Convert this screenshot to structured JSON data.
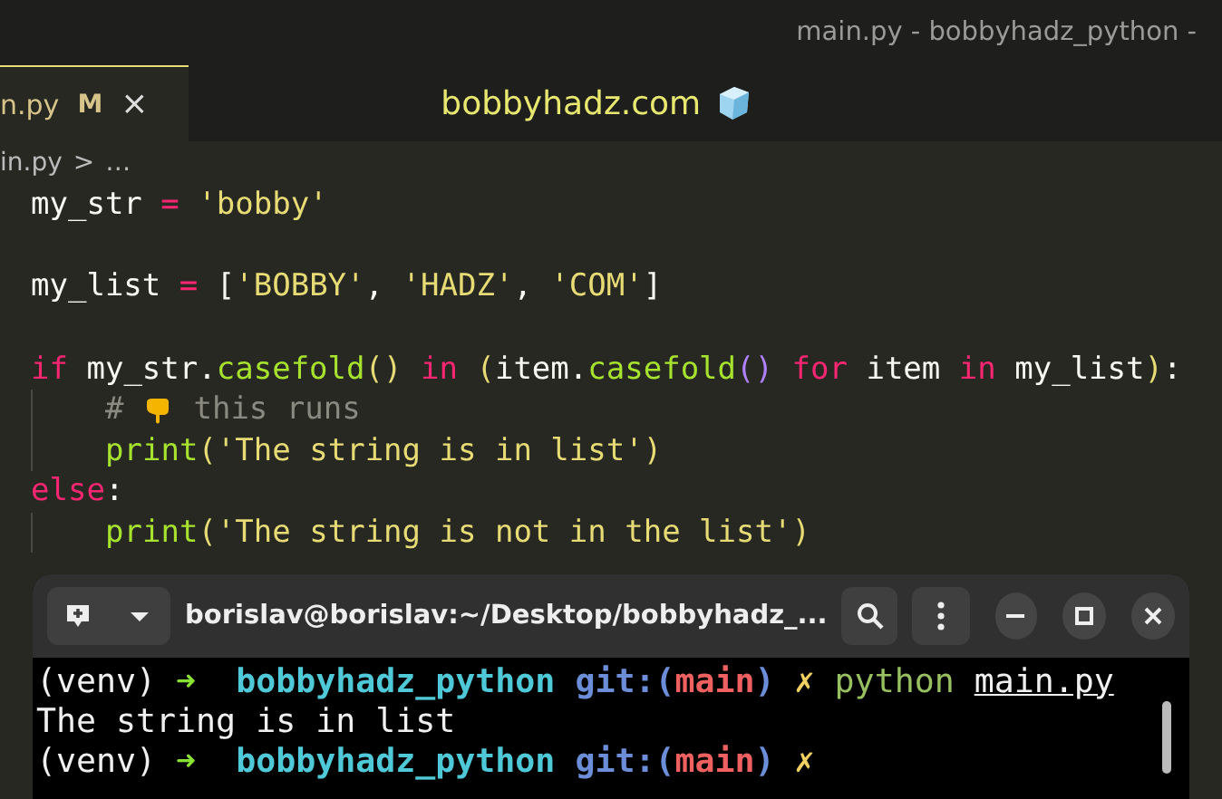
{
  "window": {
    "title": "main.py - bobbyhadz_python -"
  },
  "tabs": [
    {
      "label": "n.py",
      "badge": "M",
      "close": "×",
      "selected": true
    }
  ],
  "banner": {
    "text": "bobbyhadz.com"
  },
  "breadcrumb": {
    "file": "in.py",
    "separator": ">",
    "more": "…"
  },
  "code": [
    {
      "tokens": [
        {
          "kind": "var",
          "text": "my_str"
        },
        {
          "kind": "op",
          "text": " = "
        },
        {
          "kind": "str",
          "text": "'bobby'"
        }
      ],
      "blank_after": true
    },
    {
      "tokens": [
        {
          "kind": "var",
          "text": "my_list"
        },
        {
          "kind": "op",
          "text": " = "
        },
        {
          "kind": "plain",
          "text": "["
        },
        {
          "kind": "str",
          "text": "'BOBBY'"
        },
        {
          "kind": "plain",
          "text": ", "
        },
        {
          "kind": "str",
          "text": "'HADZ'"
        },
        {
          "kind": "plain",
          "text": ", "
        },
        {
          "kind": "str",
          "text": "'COM'"
        },
        {
          "kind": "plain",
          "text": "]"
        }
      ],
      "blank_after": true
    },
    {
      "tokens": [
        {
          "kind": "kw",
          "text": "if"
        },
        {
          "kind": "plain",
          "text": " my_str."
        },
        {
          "kind": "fn",
          "text": "casefold"
        },
        {
          "kind": "paren",
          "text": "()"
        },
        {
          "kind": "kw",
          "text": " in "
        },
        {
          "kind": "paren",
          "text": "("
        },
        {
          "kind": "plain",
          "text": "item."
        },
        {
          "kind": "fn",
          "text": "casefold"
        },
        {
          "kind": "paren2",
          "text": "()"
        },
        {
          "kind": "kw",
          "text": " for "
        },
        {
          "kind": "plain",
          "text": "item"
        },
        {
          "kind": "kw",
          "text": " in "
        },
        {
          "kind": "plain",
          "text": "my_list"
        },
        {
          "kind": "paren",
          "text": ")"
        },
        {
          "kind": "plain",
          "text": ":"
        }
      ],
      "children": [
        {
          "tokens": [
            {
              "kind": "cmt",
              "text": "# "
            },
            {
              "kind": "icon"
            },
            {
              "kind": "cmt",
              "text": " this runs"
            }
          ]
        },
        {
          "tokens": [
            {
              "kind": "fn",
              "text": "print"
            },
            {
              "kind": "paren",
              "text": "("
            },
            {
              "kind": "str",
              "text": "'The string is in list'"
            },
            {
              "kind": "paren",
              "text": ")"
            }
          ]
        }
      ]
    },
    {
      "tokens": [
        {
          "kind": "kw",
          "text": "else"
        },
        {
          "kind": "plain",
          "text": ":"
        }
      ],
      "children": [
        {
          "tokens": [
            {
              "kind": "fn",
              "text": "print"
            },
            {
              "kind": "paren",
              "text": "("
            },
            {
              "kind": "str",
              "text": "'The string is not in the list'"
            },
            {
              "kind": "paren",
              "text": ")"
            }
          ]
        }
      ]
    }
  ],
  "terminal": {
    "title": "borislav@borislav:~/Desktop/bobbyhadz_...",
    "lines": [
      {
        "tokens": [
          {
            "kind": "plain",
            "text": "(venv) "
          },
          {
            "kind": "arrow",
            "text": "➜"
          },
          {
            "kind": "dir",
            "text": "  bobbyhadz_python"
          },
          {
            "kind": "git",
            "text": " git:("
          },
          {
            "kind": "branch",
            "text": "main"
          },
          {
            "kind": "git",
            "text": ")"
          },
          {
            "kind": "dirty",
            "text": " ✗"
          },
          {
            "kind": "cmd",
            "text": " python"
          },
          {
            "kind": "file",
            "text": "main.py"
          }
        ]
      },
      {
        "tokens": [
          {
            "kind": "plain",
            "text": "The string is in list"
          }
        ]
      },
      {
        "tokens": [
          {
            "kind": "plain",
            "text": "(venv) "
          },
          {
            "kind": "arrow",
            "text": "➜"
          },
          {
            "kind": "dir",
            "text": "  bobbyhadz_python"
          },
          {
            "kind": "git",
            "text": " git:("
          },
          {
            "kind": "branch",
            "text": "main"
          },
          {
            "kind": "git",
            "text": ")"
          },
          {
            "kind": "dirty",
            "text": " ✗"
          }
        ]
      }
    ]
  }
}
